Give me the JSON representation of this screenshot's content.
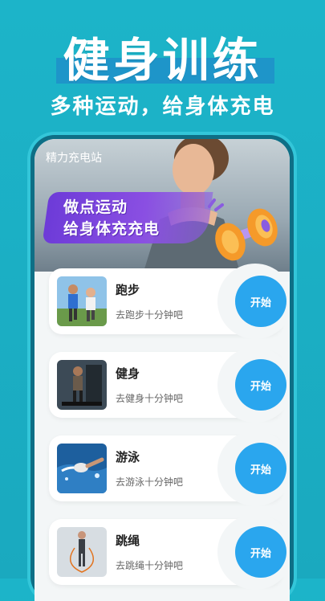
{
  "promo": {
    "title": "健身训练",
    "subtitle": "多种运动，给身体充电"
  },
  "app": {
    "title": "精力充电站",
    "banner_line1": "做点运动",
    "banner_line2": "给身体充充电"
  },
  "activities": [
    {
      "title": "跑步",
      "desc": "去跑步十分钟吧",
      "button": "开始",
      "icon": "running-couple-photo"
    },
    {
      "title": "健身",
      "desc": "去健身十分钟吧",
      "button": "开始",
      "icon": "gym-treadmill-photo"
    },
    {
      "title": "游泳",
      "desc": "去游泳十分钟吧",
      "button": "开始",
      "icon": "swimmer-photo"
    },
    {
      "title": "跳绳",
      "desc": "去跳绳十分钟吧",
      "button": "开始",
      "icon": "jump-rope-photo"
    }
  ],
  "colors": {
    "background": "#1cb4c9",
    "accent_button": "#2aa6ee",
    "banner_purple": "#7a45de"
  }
}
